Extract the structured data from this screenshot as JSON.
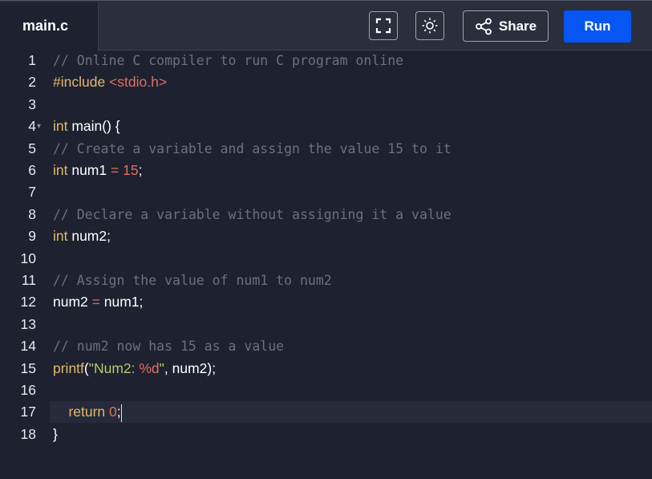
{
  "tab": {
    "filename": "main.c"
  },
  "toolbar": {
    "fullscreen_icon": "fullscreen-icon",
    "theme_icon": "sun-icon",
    "share_label": "Share",
    "run_label": "Run"
  },
  "colors": {
    "run": "#0556f3",
    "background": "#1d2130",
    "comment": "#6b7080",
    "keyword": "#e2b86b",
    "number": "#e0705f",
    "string": "#b8c866"
  },
  "lines": [
    {
      "n": "1",
      "tokens": [
        {
          "t": "comment",
          "v": "// Online C compiler to run C program online"
        }
      ]
    },
    {
      "n": "2",
      "tokens": [
        {
          "t": "preproc",
          "v": "#include "
        },
        {
          "t": "header",
          "v": "<stdio.h>"
        }
      ]
    },
    {
      "n": "3",
      "tokens": []
    },
    {
      "n": "4",
      "fold": true,
      "tokens": [
        {
          "t": "kw",
          "v": "int"
        },
        {
          "t": "plain",
          "v": " main() {"
        }
      ]
    },
    {
      "n": "5",
      "tokens": [
        {
          "t": "comment",
          "v": "// Create a variable and assign the value 15 to it"
        }
      ]
    },
    {
      "n": "6",
      "tokens": [
        {
          "t": "kw",
          "v": "int"
        },
        {
          "t": "plain",
          "v": " num1 "
        },
        {
          "t": "num",
          "v": "="
        },
        {
          "t": "plain",
          "v": " "
        },
        {
          "t": "num",
          "v": "15"
        },
        {
          "t": "plain",
          "v": ";"
        }
      ]
    },
    {
      "n": "7",
      "tokens": []
    },
    {
      "n": "8",
      "tokens": [
        {
          "t": "comment",
          "v": "// Declare a variable without assigning it a value"
        }
      ]
    },
    {
      "n": "9",
      "tokens": [
        {
          "t": "kw",
          "v": "int"
        },
        {
          "t": "plain",
          "v": " num2;"
        }
      ]
    },
    {
      "n": "10",
      "tokens": []
    },
    {
      "n": "11",
      "tokens": [
        {
          "t": "comment",
          "v": "// Assign the value of num1 to num2"
        }
      ]
    },
    {
      "n": "12",
      "tokens": [
        {
          "t": "plain",
          "v": "num2 "
        },
        {
          "t": "num",
          "v": "="
        },
        {
          "t": "plain",
          "v": " num1;"
        }
      ]
    },
    {
      "n": "13",
      "tokens": []
    },
    {
      "n": "14",
      "tokens": [
        {
          "t": "comment",
          "v": "// num2 now has 15 as a value"
        }
      ]
    },
    {
      "n": "15",
      "tokens": [
        {
          "t": "kw",
          "v": "printf"
        },
        {
          "t": "plain",
          "v": "("
        },
        {
          "t": "str",
          "v": "\"Num2: "
        },
        {
          "t": "fmt",
          "v": "%d"
        },
        {
          "t": "str",
          "v": "\""
        },
        {
          "t": "plain",
          "v": ", num2);"
        }
      ]
    },
    {
      "n": "16",
      "tokens": []
    },
    {
      "n": "17",
      "active": true,
      "tokens": [
        {
          "t": "plain",
          "v": "    "
        },
        {
          "t": "kw",
          "v": "return"
        },
        {
          "t": "plain",
          "v": " "
        },
        {
          "t": "num",
          "v": "0"
        },
        {
          "t": "plain",
          "v": ";"
        }
      ]
    },
    {
      "n": "18",
      "tokens": [
        {
          "t": "plain",
          "v": "}"
        }
      ]
    }
  ]
}
